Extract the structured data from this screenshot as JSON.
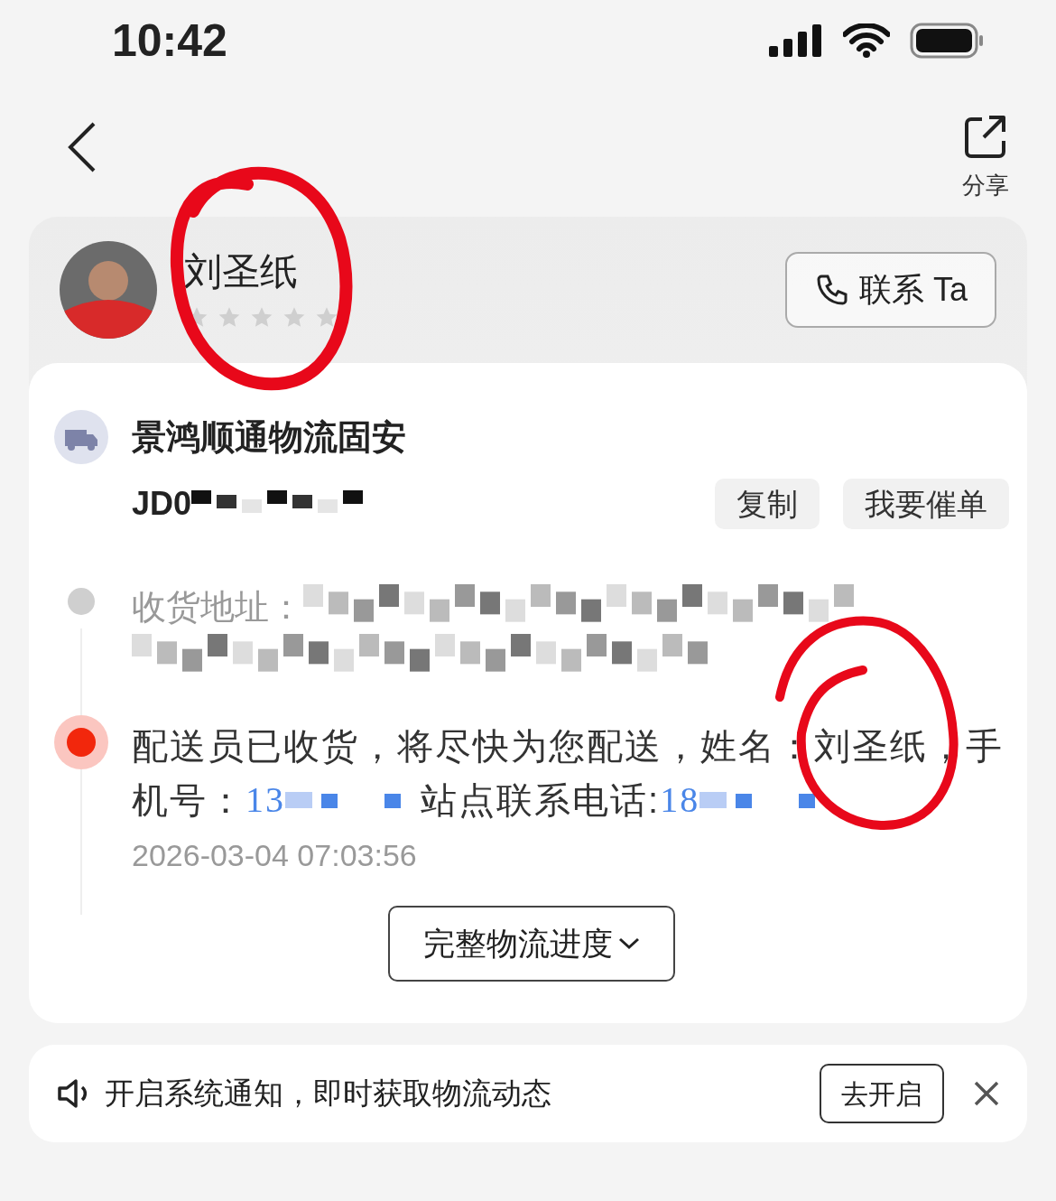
{
  "status_bar": {
    "time": "10:42"
  },
  "header": {
    "share_label": "分享"
  },
  "courier": {
    "name": "刘圣纸",
    "stars": 0,
    "contact_button": "联系 Ta"
  },
  "shipment": {
    "carrier": "景鸿顺通物流固安",
    "tracking_number": "JD0",
    "buttons": [
      {
        "label": "复制"
      },
      {
        "label": "我要催单"
      }
    ]
  },
  "timeline": [
    {
      "kind": "address",
      "current": false,
      "segments": [
        {
          "kind": "text",
          "text": "收货地址："
        }
      ]
    },
    {
      "kind": "event",
      "current": true,
      "lines": [
        [
          {
            "kind": "text",
            "text": "配送员已收货，将尽快为您配送，姓名：刘圣纸，手"
          }
        ],
        [
          {
            "kind": "text",
            "text": "机号："
          },
          {
            "kind": "phone",
            "text": "13"
          },
          {
            "kind": "text",
            "text": "站点联系电话:"
          },
          {
            "kind": "phone",
            "text": "18"
          }
        ]
      ],
      "time": "2026-03-04 07:03:56"
    }
  ],
  "full_progress_button": "完整物流进度",
  "notification": {
    "text": "开启系统通知，即时获取物流动态",
    "button": "去开启"
  }
}
